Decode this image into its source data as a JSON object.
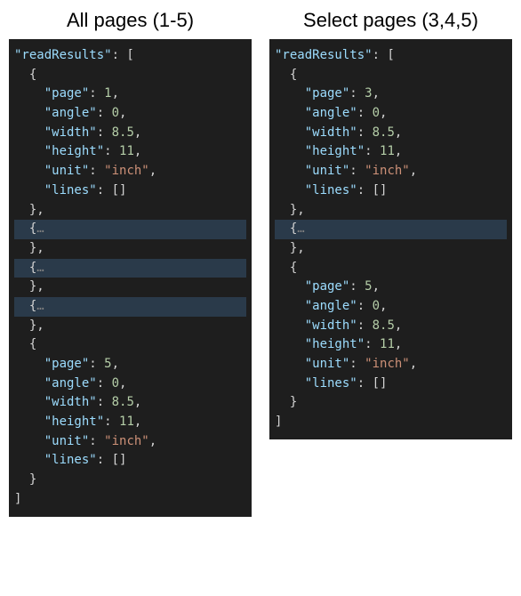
{
  "left": {
    "title": "All pages (1-5)",
    "root_key": "\"readResults\"",
    "lines": [
      {
        "indent": 0,
        "type": "root",
        "key": "\"readResults\"",
        "suffix": ": ["
      },
      {
        "indent": 1,
        "type": "brace",
        "text": "{"
      },
      {
        "indent": 2,
        "type": "kv",
        "key": "\"page\"",
        "val": "1",
        "valtype": "number",
        "comma": true
      },
      {
        "indent": 2,
        "type": "kv",
        "key": "\"angle\"",
        "val": "0",
        "valtype": "number",
        "comma": true
      },
      {
        "indent": 2,
        "type": "kv",
        "key": "\"width\"",
        "val": "8.5",
        "valtype": "number",
        "comma": true
      },
      {
        "indent": 2,
        "type": "kv",
        "key": "\"height\"",
        "val": "11",
        "valtype": "number",
        "comma": true
      },
      {
        "indent": 2,
        "type": "kv",
        "key": "\"unit\"",
        "val": "\"inch\"",
        "valtype": "string",
        "comma": true
      },
      {
        "indent": 2,
        "type": "kv",
        "key": "\"lines\"",
        "val": "[]",
        "valtype": "brace",
        "comma": false
      },
      {
        "indent": 1,
        "type": "brace",
        "text": "},"
      },
      {
        "indent": 1,
        "type": "folded"
      },
      {
        "indent": 1,
        "type": "brace",
        "text": "},"
      },
      {
        "indent": 1,
        "type": "folded"
      },
      {
        "indent": 1,
        "type": "brace",
        "text": "},"
      },
      {
        "indent": 1,
        "type": "folded"
      },
      {
        "indent": 1,
        "type": "brace",
        "text": "},"
      },
      {
        "indent": 1,
        "type": "brace",
        "text": "{"
      },
      {
        "indent": 2,
        "type": "kv",
        "key": "\"page\"",
        "val": "5",
        "valtype": "number",
        "comma": true
      },
      {
        "indent": 2,
        "type": "kv",
        "key": "\"angle\"",
        "val": "0",
        "valtype": "number",
        "comma": true
      },
      {
        "indent": 2,
        "type": "kv",
        "key": "\"width\"",
        "val": "8.5",
        "valtype": "number",
        "comma": true
      },
      {
        "indent": 2,
        "type": "kv",
        "key": "\"height\"",
        "val": "11",
        "valtype": "number",
        "comma": true
      },
      {
        "indent": 2,
        "type": "kv",
        "key": "\"unit\"",
        "val": "\"inch\"",
        "valtype": "string",
        "comma": true
      },
      {
        "indent": 2,
        "type": "kv",
        "key": "\"lines\"",
        "val": "[]",
        "valtype": "brace",
        "comma": false
      },
      {
        "indent": 1,
        "type": "brace",
        "text": "}"
      },
      {
        "indent": 0,
        "type": "brace",
        "text": "]"
      }
    ]
  },
  "right": {
    "title": "Select pages (3,4,5)",
    "root_key": "\"readResults\"",
    "lines": [
      {
        "indent": 0,
        "type": "root",
        "key": "\"readResults\"",
        "suffix": ": ["
      },
      {
        "indent": 1,
        "type": "brace",
        "text": "{"
      },
      {
        "indent": 2,
        "type": "kv",
        "key": "\"page\"",
        "val": "3",
        "valtype": "number",
        "comma": true
      },
      {
        "indent": 2,
        "type": "kv",
        "key": "\"angle\"",
        "val": "0",
        "valtype": "number",
        "comma": true
      },
      {
        "indent": 2,
        "type": "kv",
        "key": "\"width\"",
        "val": "8.5",
        "valtype": "number",
        "comma": true
      },
      {
        "indent": 2,
        "type": "kv",
        "key": "\"height\"",
        "val": "11",
        "valtype": "number",
        "comma": true
      },
      {
        "indent": 2,
        "type": "kv",
        "key": "\"unit\"",
        "val": "\"inch\"",
        "valtype": "string",
        "comma": true
      },
      {
        "indent": 2,
        "type": "kv",
        "key": "\"lines\"",
        "val": "[]",
        "valtype": "brace",
        "comma": false
      },
      {
        "indent": 1,
        "type": "brace",
        "text": "},"
      },
      {
        "indent": 1,
        "type": "folded"
      },
      {
        "indent": 1,
        "type": "brace",
        "text": "},"
      },
      {
        "indent": 1,
        "type": "brace",
        "text": "{"
      },
      {
        "indent": 2,
        "type": "kv",
        "key": "\"page\"",
        "val": "5",
        "valtype": "number",
        "comma": true
      },
      {
        "indent": 2,
        "type": "kv",
        "key": "\"angle\"",
        "val": "0",
        "valtype": "number",
        "comma": true
      },
      {
        "indent": 2,
        "type": "kv",
        "key": "\"width\"",
        "val": "8.5",
        "valtype": "number",
        "comma": true
      },
      {
        "indent": 2,
        "type": "kv",
        "key": "\"height\"",
        "val": "11",
        "valtype": "number",
        "comma": true
      },
      {
        "indent": 2,
        "type": "kv",
        "key": "\"unit\"",
        "val": "\"inch\"",
        "valtype": "string",
        "comma": true
      },
      {
        "indent": 2,
        "type": "kv",
        "key": "\"lines\"",
        "val": "[]",
        "valtype": "brace",
        "comma": false
      },
      {
        "indent": 1,
        "type": "brace",
        "text": "}"
      },
      {
        "indent": 0,
        "type": "brace",
        "text": "]"
      }
    ]
  }
}
